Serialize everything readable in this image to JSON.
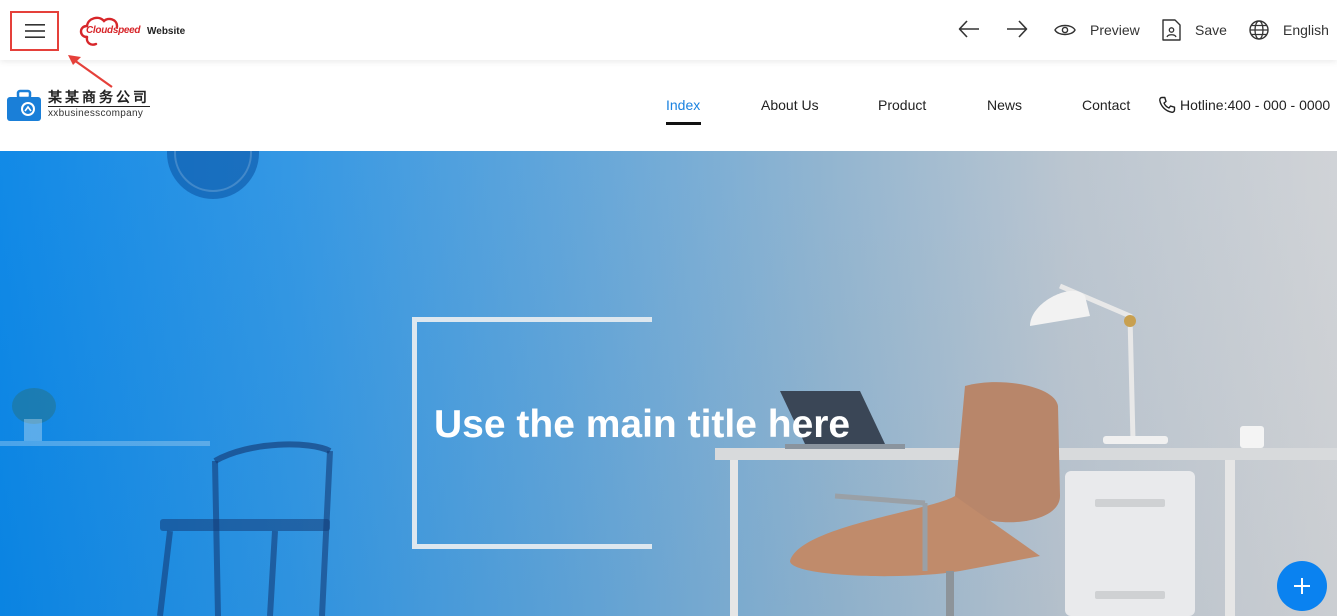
{
  "toolbar": {
    "brand_cloud_text": "Cloudspeed",
    "brand_site_text": "Website",
    "preview_label": "Preview",
    "save_label": "Save",
    "language_label": "English"
  },
  "site": {
    "logo_cn": "某某商务公司",
    "logo_en": "xxbusinesscompany",
    "nav": [
      {
        "label": "Index",
        "active": true
      },
      {
        "label": "About Us"
      },
      {
        "label": "Product"
      },
      {
        "label": "News"
      },
      {
        "label": "Contact"
      }
    ],
    "hotline": "Hotline:400 - 000 - 0000"
  },
  "hero": {
    "title": "Use the main title here"
  },
  "colors": {
    "accent": "#1a82e0",
    "highlight_border": "#e5403a",
    "fab": "#0a82f0"
  }
}
